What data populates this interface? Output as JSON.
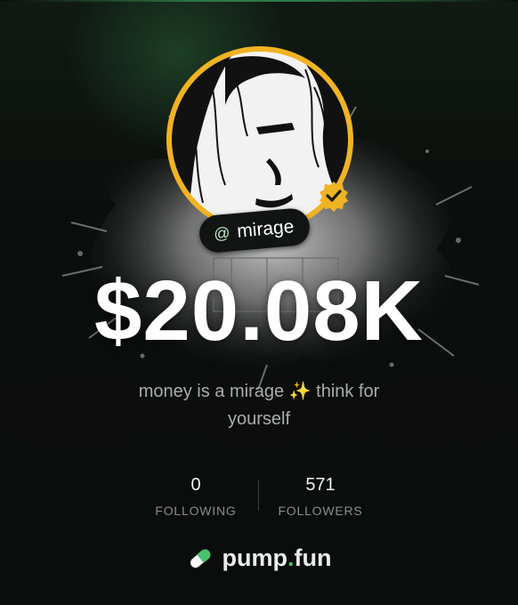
{
  "profile": {
    "handle_prefix": "@",
    "handle": "mirage",
    "value": "$20.08K",
    "bio": "money is a mirage ✨ think for yourself",
    "verified": true
  },
  "stats": {
    "following": {
      "count": "0",
      "label": "FOLLOWING"
    },
    "followers": {
      "count": "571",
      "label": "FOLLOWERS"
    }
  },
  "brand": {
    "name_part1": "pump",
    "dot": ".",
    "name_part2": "fun",
    "icon": "pill-icon"
  },
  "colors": {
    "avatar_ring": "#f0b323",
    "accent_green": "#3ec46d",
    "background": "#0d0f0e"
  }
}
